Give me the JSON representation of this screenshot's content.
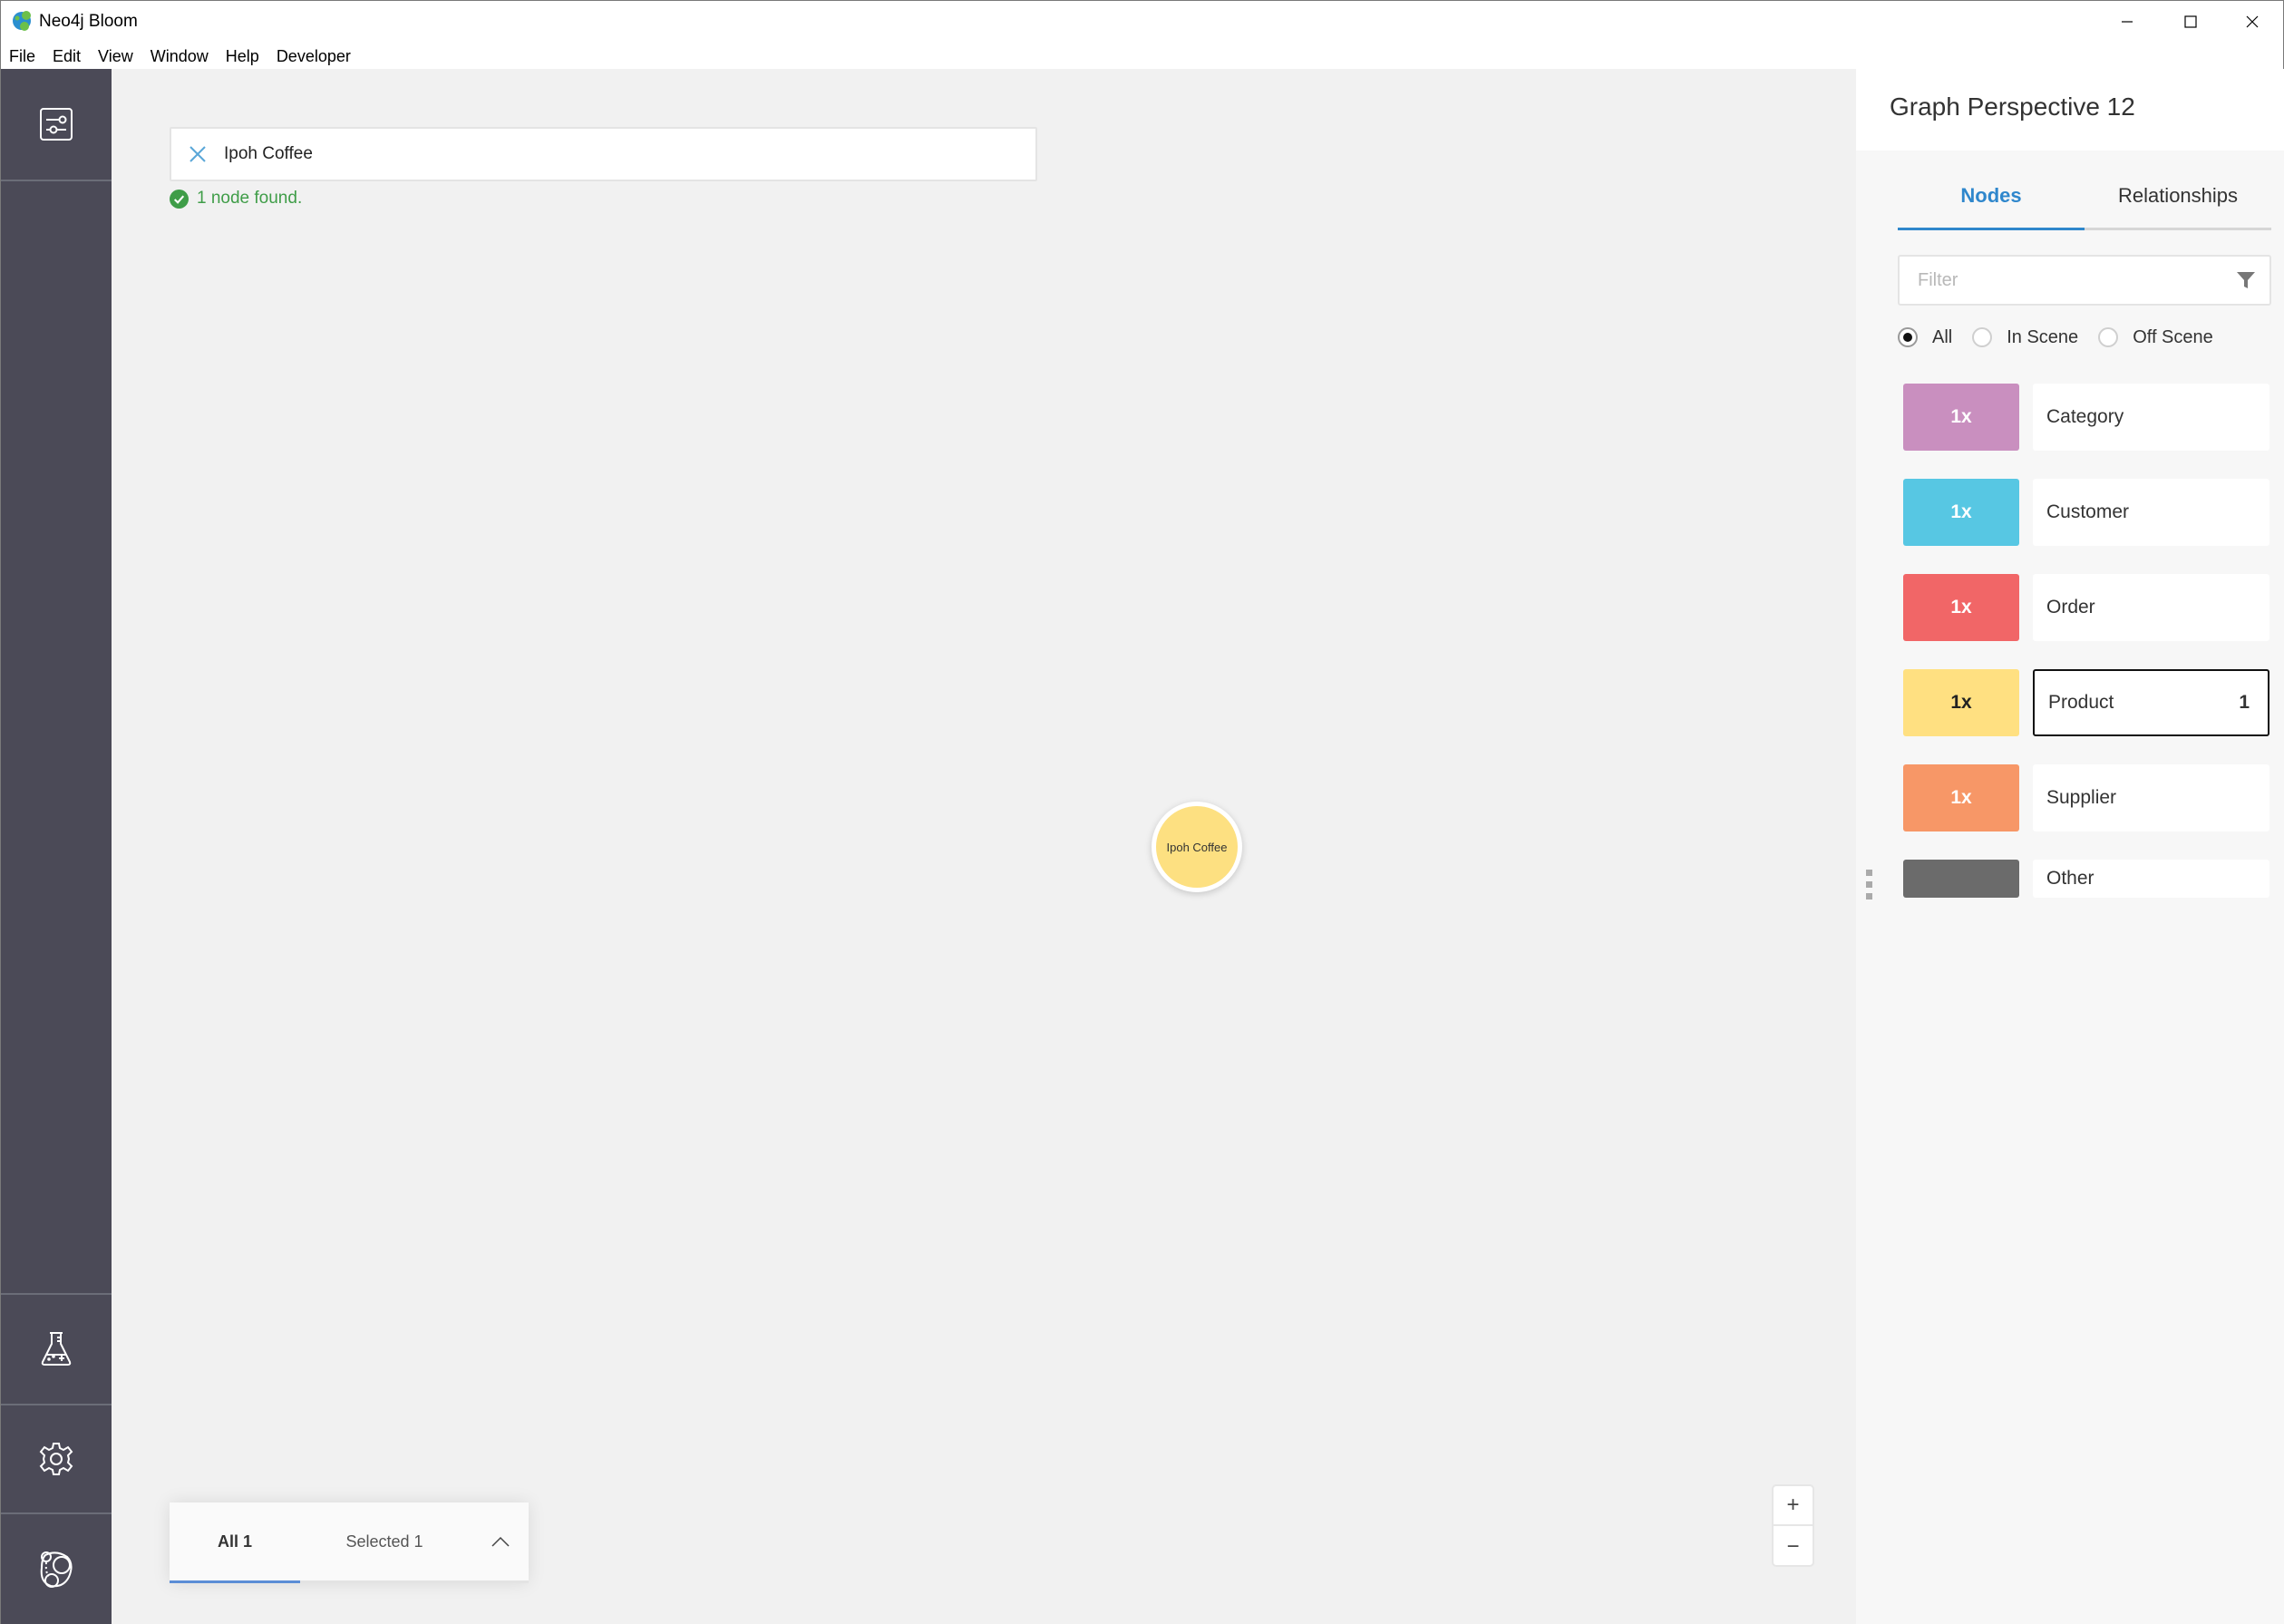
{
  "window": {
    "title": "Neo4j Bloom",
    "controls": {
      "minimize": "minimize",
      "maximize": "maximize",
      "close": "close"
    }
  },
  "menu": {
    "items": [
      "File",
      "Edit",
      "View",
      "Window",
      "Help",
      "Developer"
    ]
  },
  "sidebar": {
    "top": [
      {
        "icon": "sliders-icon",
        "label": "Perspective settings"
      }
    ],
    "bottom": [
      {
        "icon": "flask-icon",
        "label": "Experimental"
      },
      {
        "icon": "gear-icon",
        "label": "Settings"
      },
      {
        "icon": "bloom-logo-icon",
        "label": "Bloom"
      }
    ]
  },
  "search": {
    "value": "Ipoh Coffee",
    "status": "1 node found.",
    "status_color": "#3f9d48",
    "clear_icon_color": "#5aa7d8"
  },
  "graph": {
    "nodes": [
      {
        "label": "Ipoh Coffee",
        "category": "Product",
        "color": "#fde081"
      }
    ]
  },
  "results": {
    "tabs": [
      {
        "label": "All 1",
        "active": true
      },
      {
        "label": "Selected 1",
        "active": false
      }
    ],
    "toggle_icon": "chevron-up-icon"
  },
  "zoom": {
    "in_label": "+",
    "out_label": "−"
  },
  "perspective": {
    "title": "Graph Perspective 12",
    "tabs": [
      {
        "label": "Nodes",
        "active": true
      },
      {
        "label": "Relationships",
        "active": false
      }
    ],
    "filter_placeholder": "Filter",
    "radios": [
      {
        "label": "All",
        "checked": true
      },
      {
        "label": "In Scene",
        "checked": false
      },
      {
        "label": "Off Scene",
        "checked": false
      }
    ],
    "categories": [
      {
        "name": "Category",
        "size": "1x",
        "color": "#c98fbf",
        "text_color": "#ffffff",
        "count": ""
      },
      {
        "name": "Customer",
        "size": "1x",
        "color": "#57c7e3",
        "text_color": "#ffffff",
        "count": ""
      },
      {
        "name": "Order",
        "size": "1x",
        "color": "#f16667",
        "text_color": "#ffffff",
        "count": ""
      },
      {
        "name": "Product",
        "size": "1x",
        "color": "#ffe081",
        "text_color": "#222222",
        "count": "1",
        "selected": true
      },
      {
        "name": "Supplier",
        "size": "1x",
        "color": "#f79767",
        "text_color": "#ffffff",
        "count": ""
      },
      {
        "name": "Other",
        "size": "",
        "color": "#6b6b6b",
        "text_color": "#ffffff",
        "count": ""
      }
    ]
  }
}
